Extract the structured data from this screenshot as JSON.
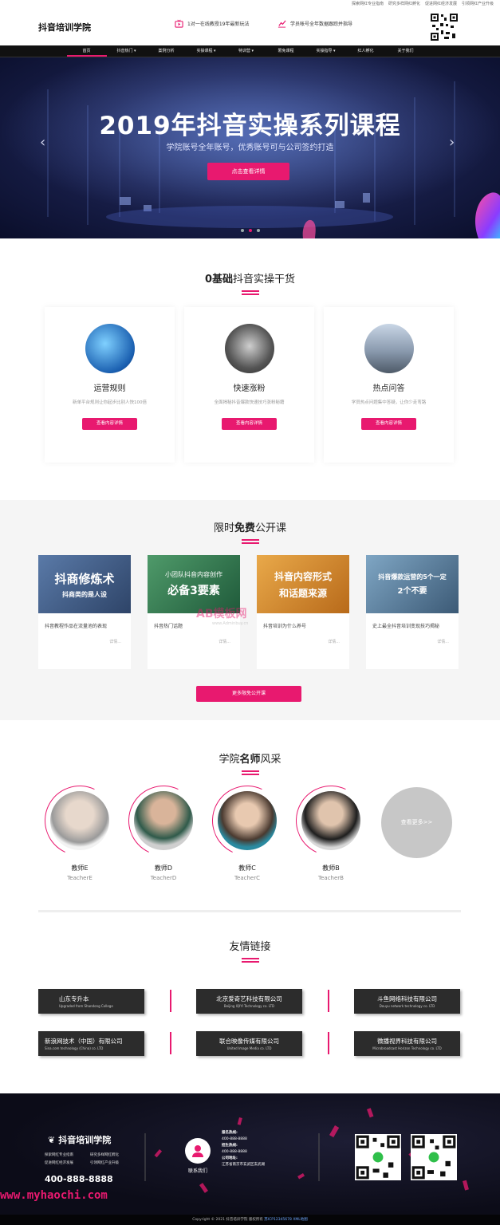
{
  "topbar": {
    "links": [
      "探索网红专业指南",
      "研究多样网红孵化",
      "促进网红经济发展",
      "引领网红产业升级"
    ]
  },
  "header": {
    "logo": "抖音培训学院",
    "feature1": "1对一在线教授19年最新玩法",
    "feature2": "学员帐号全年数据跟踪并指导"
  },
  "nav": {
    "items": [
      "首页",
      "抖音热门 ▾",
      "案例分析",
      "实操课程 ▾",
      "特训营 ▾",
      "限免课程",
      "实操指导 ▾",
      "红人孵化",
      "关于我们"
    ]
  },
  "hero": {
    "title": "2019年抖音实操系列课程",
    "subtitle": "学院账号全年账号，优秀账号可与公司签约打造",
    "button": "点击查看详情",
    "prev": "‹",
    "next": "›"
  },
  "sec1": {
    "title_bold": "0基础",
    "title_rest": "抖音实操干货",
    "cards": [
      {
        "title": "运营规则",
        "desc": "新单平台规则让你起步比别人快100倍",
        "btn": "查看内容详情"
      },
      {
        "title": "快速涨粉",
        "desc": "全面揭秘抖音爆款快速技巧涨粉秘籍",
        "btn": "查看内容详情"
      },
      {
        "title": "热点问答",
        "desc": "学员热点问题集中答疑，让你少走弯路",
        "btn": "查看内容详情"
      }
    ]
  },
  "sec2": {
    "title_a": "限时",
    "title_bold": "免费",
    "title_b": "公开课",
    "cards": [
      {
        "img_line1": "抖商修炼术",
        "img_line2": "抖商类的是人设",
        "text": "抖音教程作品在流量池的表现",
        "more": "详情..."
      },
      {
        "img_line1": "小团队抖音内容创作",
        "img_line2": "必备3要素",
        "text": "抖音热门话题",
        "more": "详情..."
      },
      {
        "img_line1": "抖音内容形式",
        "img_line2": "和话题来源",
        "text": "抖音培训为什么养号",
        "more": "详情..."
      },
      {
        "img_line1": "抖音爆款运营的5个一定",
        "img_line2": "2个不要",
        "text": "史上最全抖音培训变现技巧揭秘",
        "more": "详情..."
      }
    ],
    "more": "更多限免公开课",
    "watermark": "AB模板网",
    "watermark_sub": "www.Adminbuy.cn"
  },
  "sec3": {
    "title_a": "学院",
    "title_bold": "名师",
    "title_b": "风采",
    "teachers": [
      {
        "cn": "教师E",
        "en": "TeacherE"
      },
      {
        "cn": "教师D",
        "en": "TeacherD"
      },
      {
        "cn": "教师C",
        "en": "TeacherC"
      },
      {
        "cn": "教师B",
        "en": "TeacherB"
      }
    ],
    "more": "查看更多>>"
  },
  "sec4": {
    "title": "友情链接",
    "links": [
      {
        "cn": "山东专升本",
        "en": "Upgraded from Shandong College"
      },
      {
        "cn": "北京爱奇艺科技有限公司",
        "en": "Beijing IQIYI Technology co. LTD"
      },
      {
        "cn": "斗鱼网络科技有限公司",
        "en": "Douyu network technology co. LTD"
      },
      {
        "cn": "新浪网技术（中国）有限公司",
        "en": "Sina.com technology (China) co. LTD"
      },
      {
        "cn": "联合映像传媒有限公司",
        "en": "United Image Media co. LTD"
      },
      {
        "cn": "微播视界科技有限公司",
        "en": "Microbroadcast Horizon Technology co. LTD"
      }
    ]
  },
  "footer": {
    "logo": "抖音培训学院",
    "links": [
      "探索网红专业指南",
      "研究多样网红孵化",
      "促进网红经济发展",
      "引领网红产业升级"
    ],
    "tel": "400-888-8888",
    "contact": "联系我们",
    "info": [
      {
        "k": "报名热线:",
        "v": "400-888-8888"
      },
      {
        "k": "招生热线:",
        "v": "400-888-8888"
      },
      {
        "k": "公司地址:",
        "v": "江苏省南京市玄武区玄武湖"
      }
    ],
    "watermark": "www.myhaochi.com",
    "copyright": "Copyright © 2021 抖音培训学院 版权所有 ",
    "icp": "苏ICP12345678  XML地图"
  },
  "colors": {
    "accent": "#e8196f",
    "dark": "#111111"
  }
}
